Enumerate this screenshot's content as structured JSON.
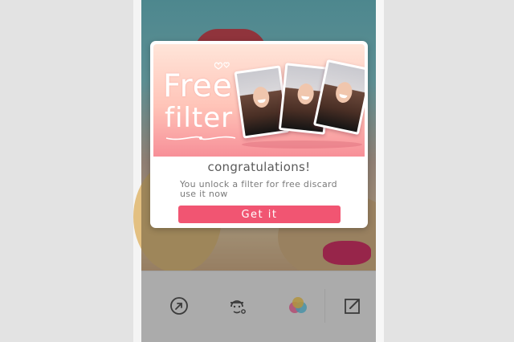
{
  "banner": {
    "headline_line1": "Free",
    "headline_line2": "filter"
  },
  "dialog": {
    "title": "congratulations!",
    "message": "You unlock a filter for free discard use it now",
    "primary_button": "Get  it"
  },
  "toolbar": {
    "tools": [
      {
        "icon": "share-icon"
      },
      {
        "icon": "face-edit-icon"
      },
      {
        "icon": "color-filter-icon"
      },
      {
        "icon": "edit-icon"
      }
    ]
  },
  "colors": {
    "accent": "#f15572",
    "banner_top": "#ffe5d9",
    "banner_bottom": "#f78f98"
  }
}
